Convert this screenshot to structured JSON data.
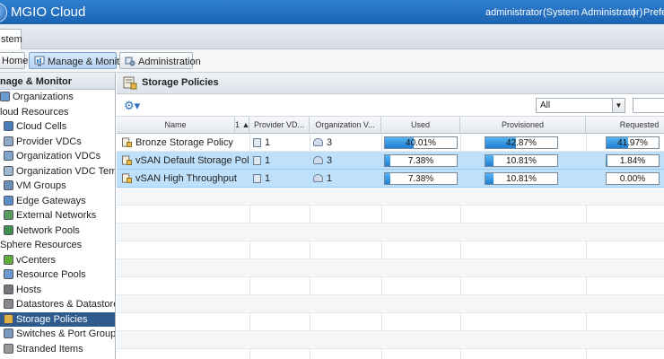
{
  "app": {
    "title": "MGIO Cloud",
    "user": "administrator",
    "role": "(System Administrator)",
    "separator": "|",
    "preferences": "Prefe"
  },
  "top_tab": {
    "label": "stem"
  },
  "nav": {
    "home": "Home",
    "manage": "Manage & Monitor",
    "admin": "Administration"
  },
  "left_panel": {
    "title": "nage & Monitor",
    "items": [
      {
        "label": "Organizations",
        "icon": "org-icon",
        "indent": 0
      },
      {
        "label": "loud Resources",
        "icon": "",
        "indent": -1
      },
      {
        "label": "Cloud Cells",
        "icon": "cell-icon",
        "indent": 1
      },
      {
        "label": "Provider VDCs",
        "icon": "vdc-icon",
        "indent": 1
      },
      {
        "label": "Organization VDCs",
        "icon": "cloud-icon",
        "indent": 1
      },
      {
        "label": "Organization VDC Templates",
        "icon": "template-icon",
        "indent": 1
      },
      {
        "label": "VM Groups",
        "icon": "vm-icon",
        "indent": 1
      },
      {
        "label": "Edge Gateways",
        "icon": "edge-icon",
        "indent": 1
      },
      {
        "label": "External Networks",
        "icon": "network-icon",
        "indent": 1
      },
      {
        "label": "Network Pools",
        "icon": "pool-icon",
        "indent": 1
      },
      {
        "label": "Sphere Resources",
        "icon": "",
        "indent": -1
      },
      {
        "label": "vCenters",
        "icon": "vcenter-icon",
        "indent": 1
      },
      {
        "label": "Resource Pools",
        "icon": "resource-pool-icon",
        "indent": 1
      },
      {
        "label": "Hosts",
        "icon": "host-icon",
        "indent": 1
      },
      {
        "label": "Datastores & Datastore Clu",
        "icon": "datastore-icon",
        "indent": 1
      },
      {
        "label": "Storage Policies",
        "icon": "storage-policy-icon",
        "indent": 1,
        "selected": true
      },
      {
        "label": "Switches & Port Groups",
        "icon": "switch-icon",
        "indent": 1
      },
      {
        "label": "Stranded Items",
        "icon": "stranded-icon",
        "indent": 1
      }
    ]
  },
  "main": {
    "title": "Storage Policies",
    "filter": {
      "value": "All"
    },
    "columns": {
      "name": "Name",
      "sort": "1 ▲",
      "provider_vdc": "Provider VD...",
      "org_vdc": "Organization V...",
      "used": "Used",
      "provisioned": "Provisioned",
      "requested": "Requested"
    },
    "rows": [
      {
        "name": "Bronze Storage Policy",
        "provider_vdcs": "1",
        "org_vdcs": "3",
        "used": "40.01%",
        "used_pct": 40.01,
        "provisioned": "42.87%",
        "provisioned_pct": 42.87,
        "requested": "41.97%",
        "requested_pct": 41.97,
        "selected": false
      },
      {
        "name": "vSAN Default Storage Policy",
        "provider_vdcs": "1",
        "org_vdcs": "3",
        "used": "7.38%",
        "used_pct": 7.38,
        "provisioned": "10.81%",
        "provisioned_pct": 10.81,
        "requested": "1.84%",
        "requested_pct": 1.84,
        "selected": true
      },
      {
        "name": "vSAN High Throughput",
        "provider_vdcs": "1",
        "org_vdcs": "1",
        "used": "7.38%",
        "used_pct": 7.38,
        "provisioned": "10.81%",
        "provisioned_pct": 10.81,
        "requested": "0.00%",
        "requested_pct": 0.0,
        "selected": true
      }
    ]
  }
}
